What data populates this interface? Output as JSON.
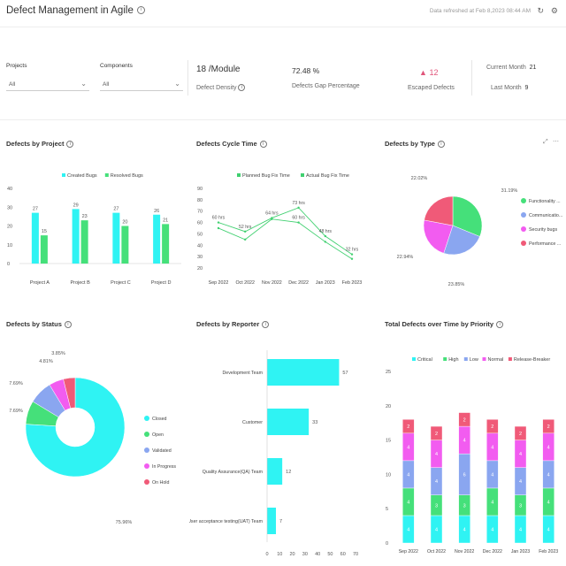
{
  "header": {
    "title": "Defect Management in Agile",
    "refreshed": "Data refreshed at Feb 8,2023 08:44 AM"
  },
  "filters": [
    {
      "label": "Projects",
      "value": "All"
    },
    {
      "label": "Components",
      "value": "All"
    }
  ],
  "kpis": {
    "density_value": "18 /Module",
    "density_label": "Defect Density",
    "gap_value": "72.48 %",
    "gap_label": "Defects Gap Percentage",
    "escaped_value": "12",
    "escaped_label": "Escaped Defects",
    "current_month_label": "Current Month",
    "current_month_value": "21",
    "last_month_label": "Last Month",
    "last_month_value": "9"
  },
  "colors": {
    "cyan": "#2ff3f3",
    "green": "#45e07a",
    "blue": "#8aa6f0",
    "magenta": "#f25cf0",
    "red": "#f05a78",
    "lime": "#40d070"
  },
  "chart_data": [
    {
      "id": "by_project",
      "type": "bar",
      "title": "Defects by Project",
      "categories": [
        "Project A",
        "Project B",
        "Project C",
        "Project D"
      ],
      "series": [
        {
          "name": "Created Bugs",
          "values": [
            27,
            29,
            27,
            26
          ]
        },
        {
          "name": "Resolved Bugs",
          "values": [
            15,
            23,
            20,
            21
          ]
        }
      ],
      "ylim": [
        0,
        40
      ],
      "yticks": [
        0,
        10,
        20,
        30,
        40
      ],
      "legend": "top"
    },
    {
      "id": "cycle_time",
      "type": "line",
      "title": "Defects Cycle Time",
      "categories": [
        "Sep 2022",
        "Oct 2022",
        "Nov 2022",
        "Dec 2022",
        "Jan 2023",
        "Feb 2023"
      ],
      "series": [
        {
          "name": "Planned Bug Fix Time",
          "values": [
            60,
            52,
            64,
            73,
            48,
            32
          ],
          "labels": [
            "60 hrs",
            "52 hrs",
            "64 hrs",
            "73 hrs",
            "48 hrs",
            "32 hrs"
          ]
        },
        {
          "name": "Actual Bug Fix Time",
          "values": [
            55,
            45,
            63,
            60,
            43,
            28
          ],
          "labels": [
            "",
            "",
            "",
            "60 hrs",
            "",
            ""
          ]
        }
      ],
      "ylim": [
        20,
        90
      ],
      "yticks": [
        20,
        30,
        40,
        50,
        60,
        70,
        80,
        90
      ],
      "legend": "top"
    },
    {
      "id": "by_type",
      "type": "pie",
      "title": "Defects by Type",
      "slices": [
        {
          "name": "Functionality ...",
          "value": 31.19,
          "label": "31.19%"
        },
        {
          "name": "Communicatio...",
          "value": 23.85,
          "label": "23.85%"
        },
        {
          "name": "Security bugs",
          "value": 22.94,
          "label": "22.94%"
        },
        {
          "name": "Performance ...",
          "value": 22.02,
          "label": "22.02%"
        }
      ],
      "legend": "right"
    },
    {
      "id": "by_status",
      "type": "pie",
      "title": "Defects by Status",
      "slices": [
        {
          "name": "Closed",
          "value": 75.96,
          "label": "75.96%"
        },
        {
          "name": "Open",
          "value": 7.69,
          "label": "7.69%"
        },
        {
          "name": "Validated",
          "value": 7.69,
          "label": "7.69%"
        },
        {
          "name": "In Progress",
          "value": 4.81,
          "label": "4.81%"
        },
        {
          "name": "On Hold",
          "value": 3.85,
          "label": "3.85%"
        }
      ],
      "legend": "right"
    },
    {
      "id": "by_reporter",
      "type": "bar",
      "title": "Defects by Reporter",
      "orientation": "horizontal",
      "categories": [
        "Development Team",
        "Customer",
        "Quality Assurance(QA) Team",
        "User acceptance testing(UAT) Team"
      ],
      "values": [
        57,
        33,
        12,
        7
      ],
      "xlim": [
        0,
        70
      ],
      "xticks": [
        0,
        10,
        20,
        30,
        40,
        50,
        60,
        70
      ]
    },
    {
      "id": "over_time",
      "type": "bar",
      "stacked": true,
      "title": "Total Defects over Time by Priority",
      "categories": [
        "Sep 2022",
        "Oct 2022",
        "Nov 2022",
        "Dec 2022",
        "Jan 2023",
        "Feb 2023"
      ],
      "series": [
        {
          "name": "Critical",
          "values": [
            4,
            4,
            4,
            4,
            4,
            4
          ]
        },
        {
          "name": "High",
          "values": [
            4,
            3,
            3,
            4,
            3,
            4
          ]
        },
        {
          "name": "Low",
          "values": [
            4,
            4,
            6,
            4,
            4,
            4
          ]
        },
        {
          "name": "Normal",
          "values": [
            4,
            4,
            4,
            4,
            4,
            4
          ]
        },
        {
          "name": "Release-Breaker",
          "values": [
            2,
            2,
            2,
            2,
            2,
            2
          ]
        }
      ],
      "ylim": [
        0,
        25
      ],
      "yticks": [
        0,
        5,
        10,
        15,
        20,
        25
      ],
      "legend": "top"
    }
  ]
}
